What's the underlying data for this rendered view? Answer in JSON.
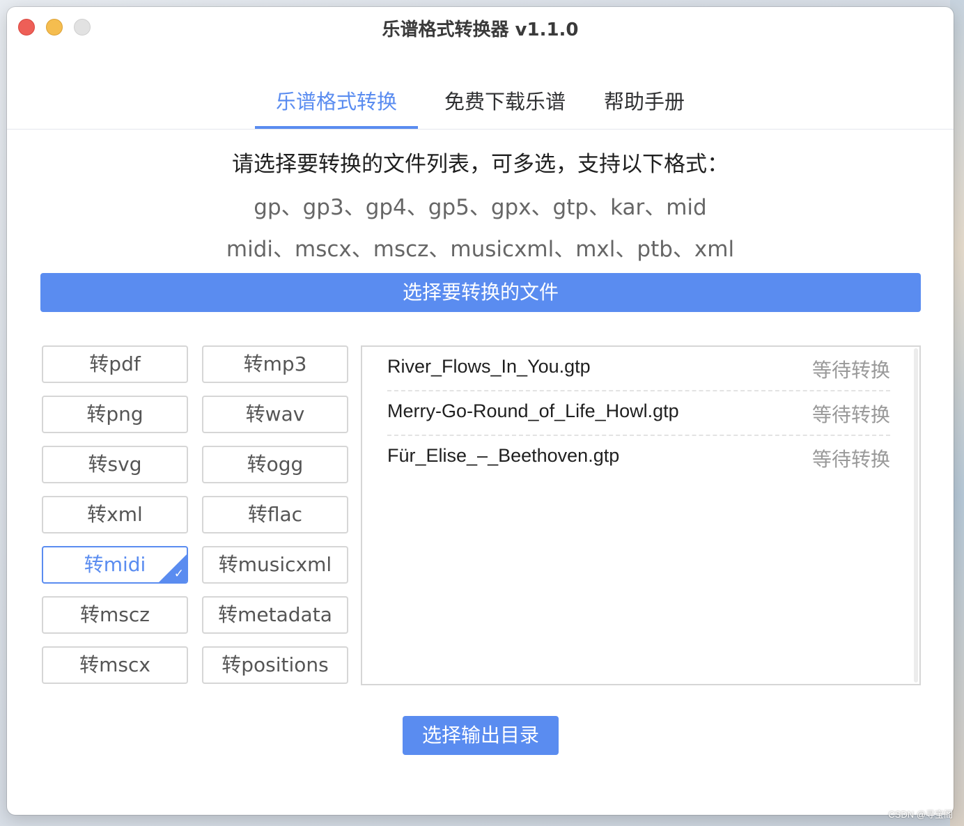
{
  "window": {
    "title": "乐谱格式转换器 v1.1.0"
  },
  "tabs": [
    {
      "label": "乐谱格式转换",
      "active": true
    },
    {
      "label": "免费下载乐谱",
      "active": false
    },
    {
      "label": "帮助手册",
      "active": false
    }
  ],
  "instructions": {
    "heading": "请选择要转换的文件列表，可多选，支持以下格式：",
    "formats_line1": "gp、gp3、gp4、gp5、gpx、gtp、kar、mid",
    "formats_line2": "midi、mscx、mscz、musicxml、mxl、ptb、xml"
  },
  "select_file_button": "选择要转换的文件",
  "format_buttons": [
    {
      "label": "转pdf",
      "selected": false
    },
    {
      "label": "转mp3",
      "selected": false
    },
    {
      "label": "转png",
      "selected": false
    },
    {
      "label": "转wav",
      "selected": false
    },
    {
      "label": "转svg",
      "selected": false
    },
    {
      "label": "转ogg",
      "selected": false
    },
    {
      "label": "转xml",
      "selected": false
    },
    {
      "label": "转flac",
      "selected": false
    },
    {
      "label": "转midi",
      "selected": true
    },
    {
      "label": "转musicxml",
      "selected": false
    },
    {
      "label": "转mscz",
      "selected": false
    },
    {
      "label": "转metadata",
      "selected": false
    },
    {
      "label": "转mscx",
      "selected": false
    },
    {
      "label": "转positions",
      "selected": false
    }
  ],
  "files": [
    {
      "name": "River_Flows_In_You.gtp",
      "status": "等待转换"
    },
    {
      "name": "Merry-Go-Round_of_Life_Howl.gtp",
      "status": "等待转换"
    },
    {
      "name": "Für_Elise_–_Beethoven.gtp",
      "status": "等待转换"
    }
  ],
  "output_button": "选择输出目录",
  "watermark": "CSDN @寻宝阁",
  "colors": {
    "accent": "#5a8cf0",
    "muted_text": "#999999"
  },
  "icons": {
    "check": "checkmark-icon"
  }
}
